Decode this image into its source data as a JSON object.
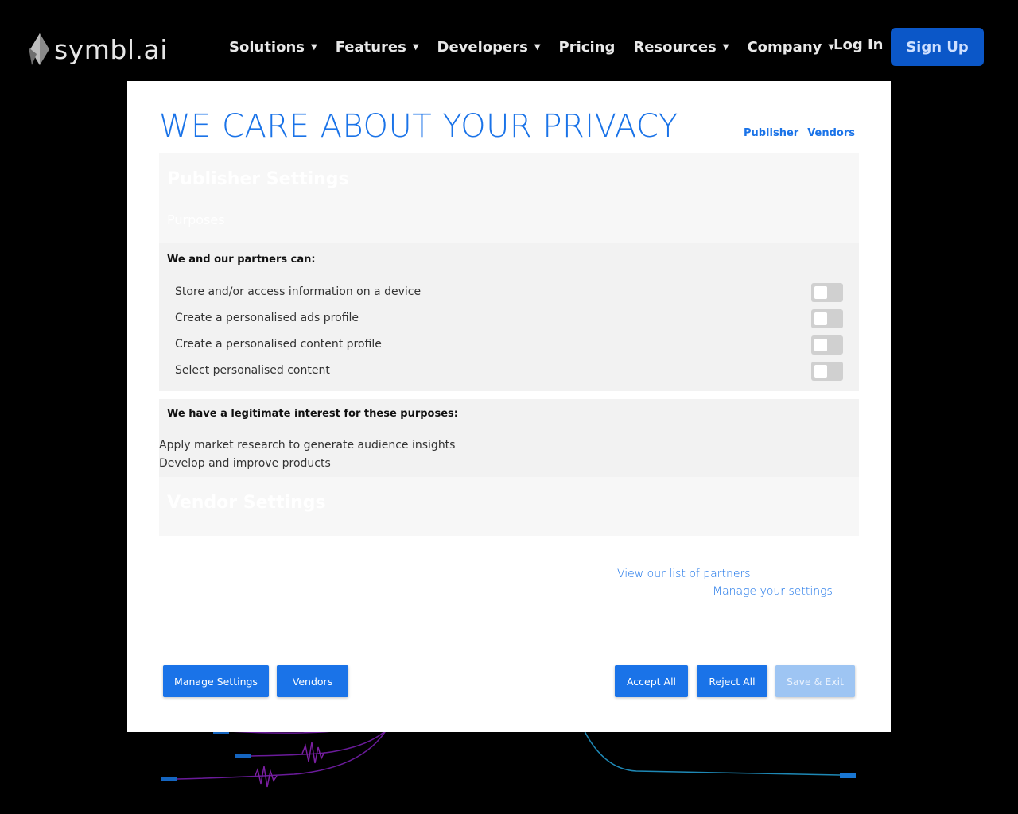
{
  "header": {
    "logo_text": "symbl.ai",
    "nav": [
      {
        "label": "Solutions",
        "has_dropdown": true
      },
      {
        "label": "Features",
        "has_dropdown": true
      },
      {
        "label": "Developers",
        "has_dropdown": true
      },
      {
        "label": "Pricing",
        "has_dropdown": false
      },
      {
        "label": "Resources",
        "has_dropdown": true
      },
      {
        "label": "Company",
        "has_dropdown": true
      }
    ],
    "login_label": "Log In",
    "signup_label": "Sign Up"
  },
  "modal": {
    "title": "WE CARE ABOUT YOUR PRIVACY",
    "top_links": {
      "publisher": "Publisher",
      "vendors": "Vendors"
    },
    "publisher_settings": {
      "title": "Publisher Settings",
      "subtitle": "Purposes"
    },
    "partners_heading": "We and our partners can:",
    "purposes": [
      {
        "label": "Store and/or access information on a device",
        "enabled": false
      },
      {
        "label": "Create a personalised ads profile",
        "enabled": false
      },
      {
        "label": "Create a personalised content profile",
        "enabled": false
      },
      {
        "label": "Select personalised content",
        "enabled": false
      }
    ],
    "legit_heading": "We have a legitimate interest for these purposes:",
    "legit_items": [
      "Apply market research to generate audience insights",
      "Develop and improve products"
    ],
    "vendor_settings_title": "Vendor Settings",
    "links": {
      "partners": "View our list of partners",
      "manage": "Manage your settings"
    },
    "buttons": {
      "manage_settings": "Manage Settings",
      "vendors": "Vendors",
      "accept_all": "Accept All",
      "reject_all": "Reject All",
      "save_exit": "Save & Exit"
    }
  },
  "colors": {
    "brand_blue": "#1a73e8",
    "signup_blue": "#0b57c8",
    "disabled_blue": "#9ec5f3"
  }
}
